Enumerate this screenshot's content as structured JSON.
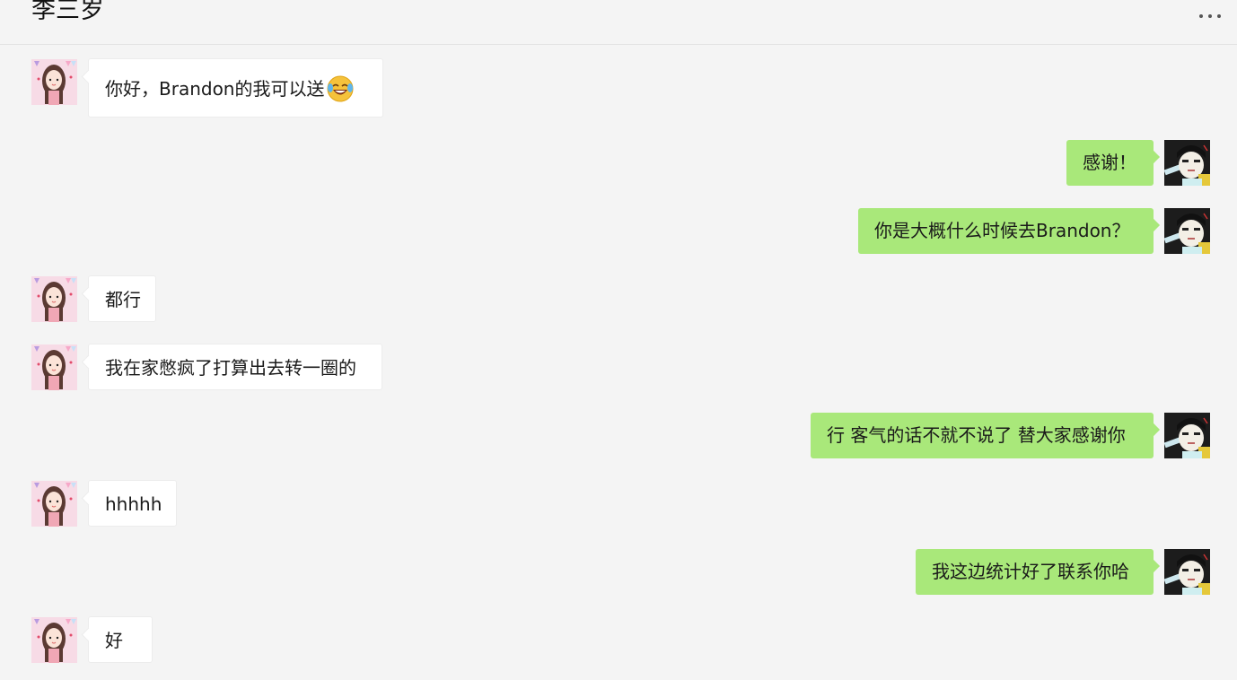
{
  "chat": {
    "title": "李三岁",
    "more_icon": "more-dots-icon"
  },
  "messages": [
    {
      "side": "in",
      "text": "你好，Brandon的我可以送",
      "emoji": "rolling-on-floor-laughing-emoji"
    },
    {
      "side": "out",
      "text": "感谢！"
    },
    {
      "side": "out",
      "text": "你是大概什么时候去Brandon？"
    },
    {
      "side": "in",
      "text": "都行"
    },
    {
      "side": "in",
      "text": "我在家憋疯了打算出去转一圈的"
    },
    {
      "side": "out",
      "text": "行 客气的话不就不说了 替大家感谢你"
    },
    {
      "side": "in",
      "text": "hhhhh"
    },
    {
      "side": "out",
      "text": "我这边统计好了联系你哈"
    },
    {
      "side": "in",
      "text": "好"
    }
  ],
  "colors": {
    "background": "#f4f4f4",
    "incoming_bubble": "#ffffff",
    "outgoing_bubble": "#a9e87a"
  }
}
